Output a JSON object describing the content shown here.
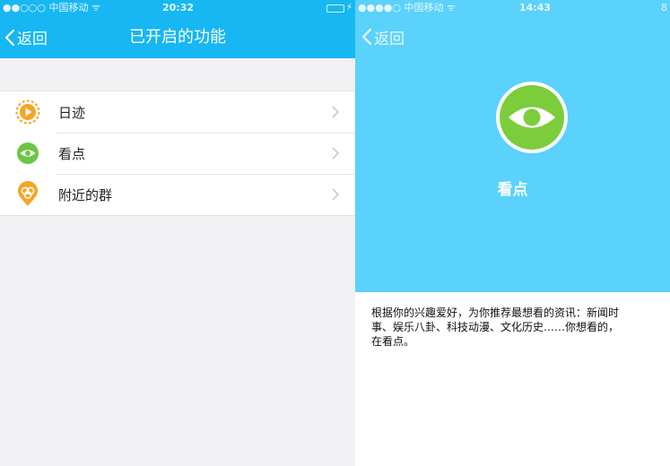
{
  "left_screen": {
    "status_bar": {
      "carrier": "●●○○○ 中国移动 ᯤ",
      "time": "20:32",
      "charging": "⚡"
    },
    "nav": {
      "back_label": "返回",
      "title": "已开启的功能"
    },
    "items": [
      {
        "label": "日迹",
        "icon": "play-record-icon",
        "color": "#f5a623"
      },
      {
        "label": "看点",
        "icon": "eye-icon",
        "color": "#6cc644"
      },
      {
        "label": "附近的群",
        "icon": "nearby-group-icon",
        "color": "#f5a623"
      }
    ]
  },
  "right_screen": {
    "status_bar": {
      "carrier": "●●●●○ 中国移动 ᯤ",
      "time": "14:43",
      "extra": "8"
    },
    "nav": {
      "back_label": "返回"
    },
    "feature": {
      "name": "看点",
      "icon": "eye-icon",
      "color": "#7ccd3c"
    },
    "description_lines": [
      "根据你的兴趣爱好，为你推荐最想看的资讯：新闻时",
      "事、娱乐八卦、科技动漫、文化历史……你想看的，",
      "在看点。"
    ]
  },
  "colors": {
    "nav_blue": "#16b7f2",
    "hero_blue": "#5ad2fb",
    "green": "#7ccd3c",
    "orange": "#f5a623"
  }
}
